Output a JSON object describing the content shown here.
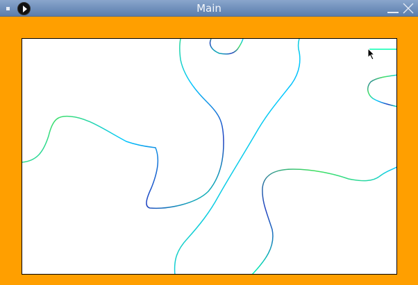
{
  "window": {
    "title": "Main",
    "icons": {
      "menu": "window-menu-icon",
      "app": "play-icon",
      "minimize": "minimize-icon",
      "close": "close-icon"
    }
  },
  "colors": {
    "frame_background": "#ff9f00",
    "titlebar": "#6f8fbb",
    "canvas_background": "#ffffff",
    "curve_colors": [
      "#00ffb0",
      "#2040c0",
      "#40e060",
      "#00c8ff"
    ]
  }
}
